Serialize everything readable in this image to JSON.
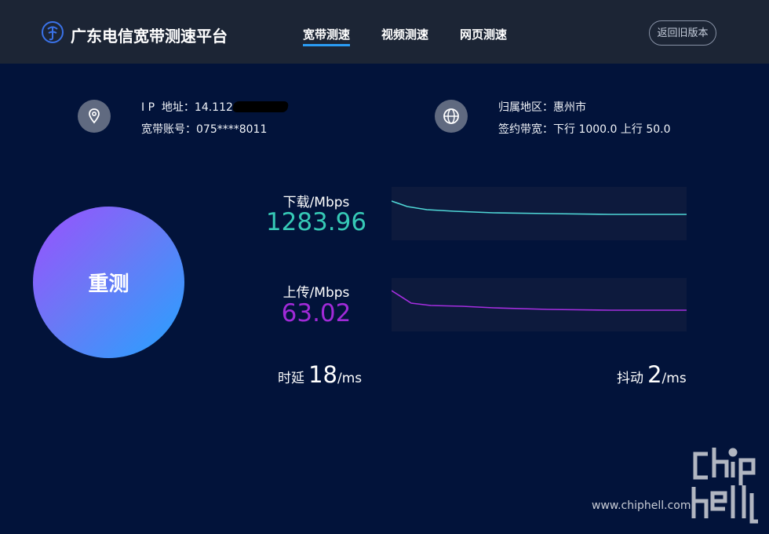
{
  "header": {
    "brand": "广东电信宽带测速平台",
    "nav": [
      {
        "label": "宽带测速",
        "active": true
      },
      {
        "label": "视频测速",
        "active": false
      },
      {
        "label": "网页测速",
        "active": false
      }
    ],
    "old_version_label": "返回旧版本"
  },
  "info": {
    "ip_label": "I P  地址：",
    "ip_value": "14.112",
    "account_label": "宽带账号：",
    "account_value": "075****8011",
    "region_label": "归属地区：",
    "region_value": "惠州市",
    "bandwidth_label": "签约带宽：",
    "bandwidth_value": "下行 1000.0 上行 50.0"
  },
  "retest_label": "重测",
  "download": {
    "label": "下载/Mbps",
    "value": "1283.96",
    "color": "#36c9b6",
    "line_color": "#4fd6d6"
  },
  "upload": {
    "label": "上传/Mbps",
    "value": "63.02",
    "color": "#a12ad8",
    "line_color": "#a52ee0"
  },
  "latency": {
    "label": "时延",
    "value": "18",
    "unit": "/ms"
  },
  "jitter": {
    "label": "抖动",
    "value": "2",
    "unit": "/ms"
  },
  "watermark": {
    "url": "www.chiphell.com",
    "logo_text": "chip hell"
  },
  "colors": {
    "background": "#02133a",
    "topbar": "#1c2535",
    "accent": "#2a9cf4"
  }
}
